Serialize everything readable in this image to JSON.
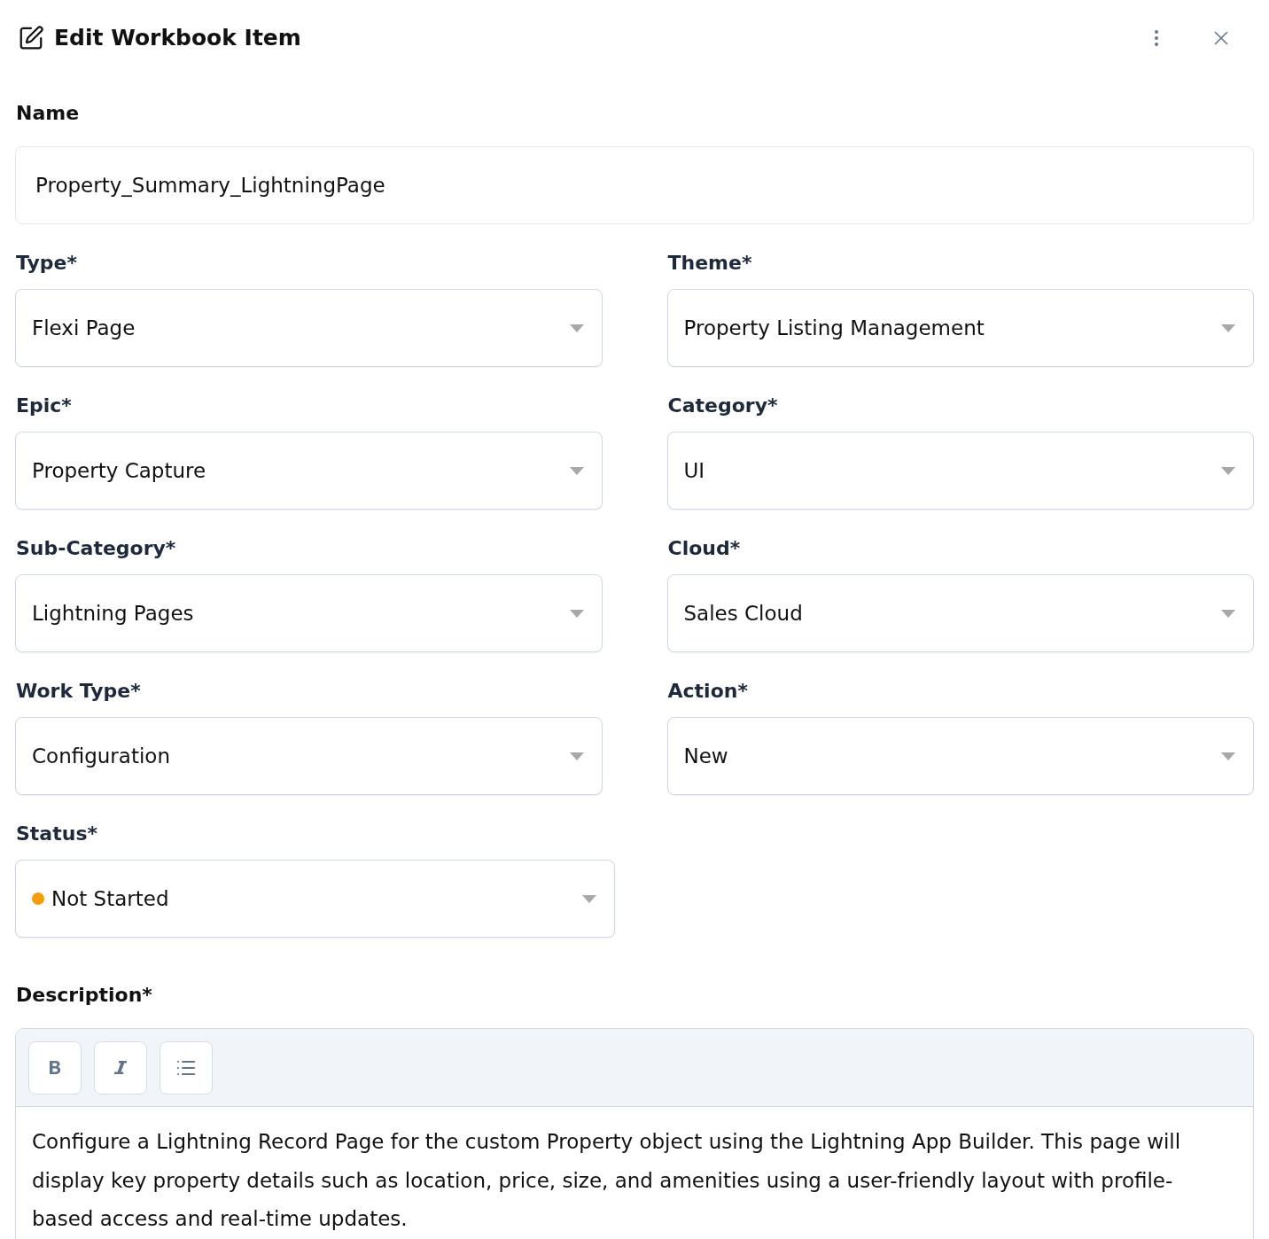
{
  "header": {
    "title": "Edit Workbook Item"
  },
  "name_field": {
    "label": "Name",
    "value": "Property_Summary_LightningPage"
  },
  "fields": [
    {
      "label": "Type*",
      "value": "Flexi Page"
    },
    {
      "label": "Theme*",
      "value": "Property Listing Management"
    },
    {
      "label": "Epic*",
      "value": "Property Capture"
    },
    {
      "label": "Category*",
      "value": "UI"
    },
    {
      "label": "Sub-Category*",
      "value": "Lightning Pages"
    },
    {
      "label": "Cloud*",
      "value": "Sales Cloud"
    },
    {
      "label": "Work Type*",
      "value": "Configuration"
    },
    {
      "label": "Action*",
      "value": "New"
    }
  ],
  "status_field": {
    "label": "Status*",
    "value": "Not Started",
    "color": "#f59e0b"
  },
  "description": {
    "label": "Description*",
    "toolbar": [
      {
        "kind": "bold"
      },
      {
        "kind": "italic"
      },
      {
        "kind": "list"
      }
    ],
    "text": "Configure a Lightning Record Page for the custom Property object using the Lightning App Builder. This page will display key property details such as location, price, size, and amenities using a user-friendly layout with profile-based access and real-time updates."
  }
}
